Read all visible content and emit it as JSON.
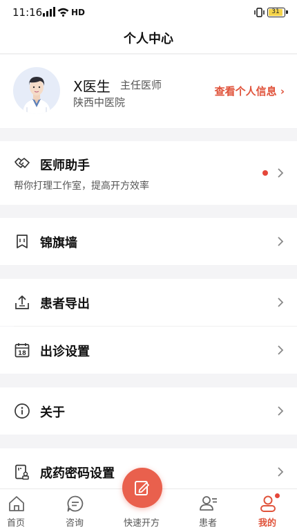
{
  "status_bar": {
    "time": "11:16",
    "network": "HD",
    "battery": "31"
  },
  "header": {
    "title": "个人中心"
  },
  "profile": {
    "name": "X医生",
    "title": "主任医师",
    "hospital": "陕西中医院",
    "view_info_label": "查看个人信息 ›"
  },
  "assistant": {
    "label": "医师助手",
    "subtitle": "帮你打理工作室，提高开方效率"
  },
  "menu": {
    "banner_wall": "锦旗墙",
    "patient_export": "患者导出",
    "clinic_settings": "出诊设置",
    "about": "关于",
    "password_settings": "成药密码设置"
  },
  "icons": {
    "assistant": "handshake-icon",
    "banner_wall": "banner-icon",
    "patient_export": "export-icon",
    "clinic_settings": "calendar-icon",
    "about": "info-icon",
    "password_settings": "password-icon"
  },
  "tabbar": {
    "items": [
      {
        "label": "首页",
        "icon": "home-icon"
      },
      {
        "label": "咨询",
        "icon": "chat-icon"
      },
      {
        "label": "快速开方",
        "icon": "prescribe-icon"
      },
      {
        "label": "患者",
        "icon": "patients-icon"
      },
      {
        "label": "我的",
        "icon": "profile-icon"
      }
    ],
    "active_color": "#e0533b"
  },
  "colors": {
    "accent": "#e0533b",
    "dot": "#e5473a",
    "background": "#f4f4f6"
  }
}
